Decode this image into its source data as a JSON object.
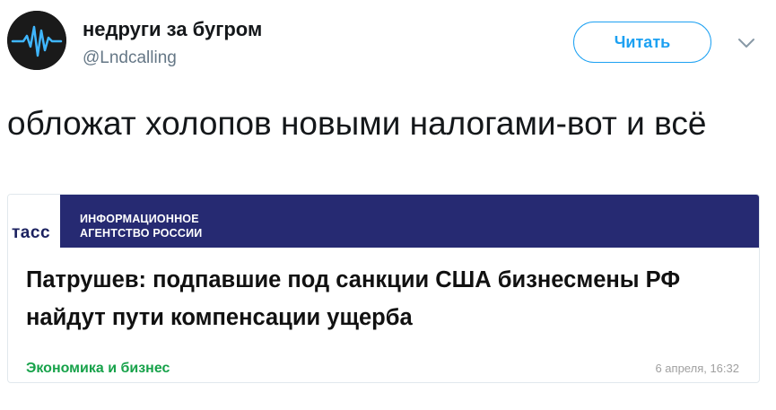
{
  "header": {
    "display_name": "недруги за бугром",
    "handle": "@Lndcalling",
    "follow_label": "Читать",
    "avatar_icon": "waveform-icon",
    "menu_icon": "chevron-down-icon"
  },
  "tweet": {
    "text": "обложат холопов новыми налогами-вот и всё"
  },
  "card": {
    "logo_text": "тасс",
    "banner_line1": "ИНФОРМАЦИОННОЕ",
    "banner_line2": "АГЕНТСТВО РОССИИ",
    "headline": "Патрушев: подпавшие под санкции США бизнесмены РФ найдут пути компенсации ущерба",
    "category": "Экономика и бизнес",
    "timestamp": "6 апреля, 16:32"
  },
  "colors": {
    "accent": "#1da1f2",
    "banner": "#262a72",
    "category": "#17a24a"
  }
}
